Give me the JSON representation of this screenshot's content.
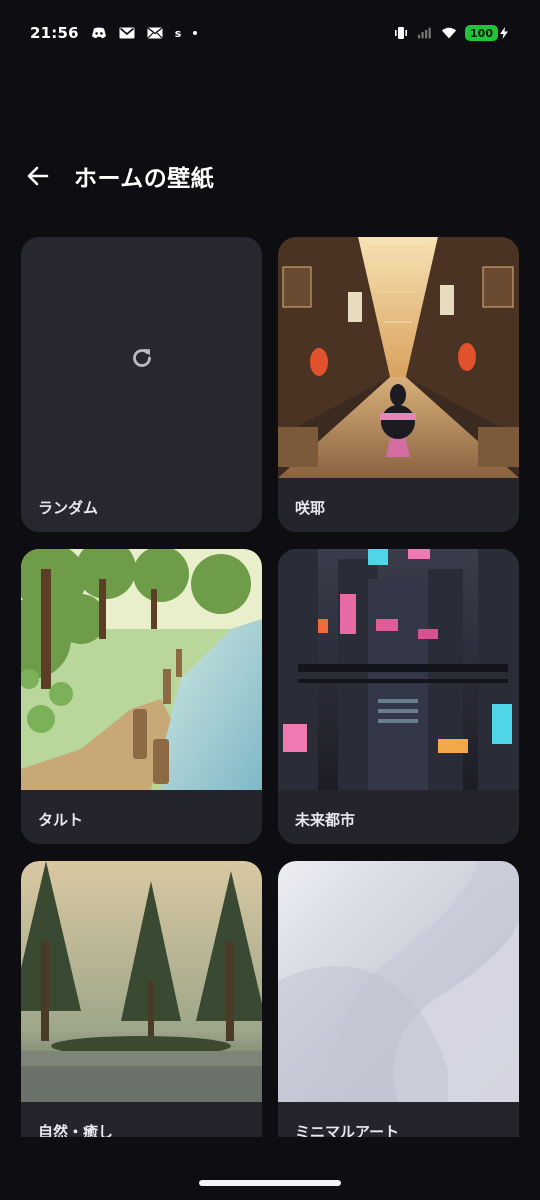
{
  "status_bar": {
    "time": "21:56",
    "notifications": [
      "discord-icon",
      "gmail-icon",
      "mail-icon"
    ],
    "small_text": "s",
    "battery_level": "100",
    "battery_color": "#22c43a"
  },
  "header": {
    "title": "ホームの壁紙"
  },
  "wallpapers": [
    {
      "label": "ランダム"
    },
    {
      "label": "咲耶"
    },
    {
      "label": "タルト"
    },
    {
      "label": "未来都市"
    },
    {
      "label": "自然・癒し"
    },
    {
      "label": "ミニマルアート"
    }
  ]
}
